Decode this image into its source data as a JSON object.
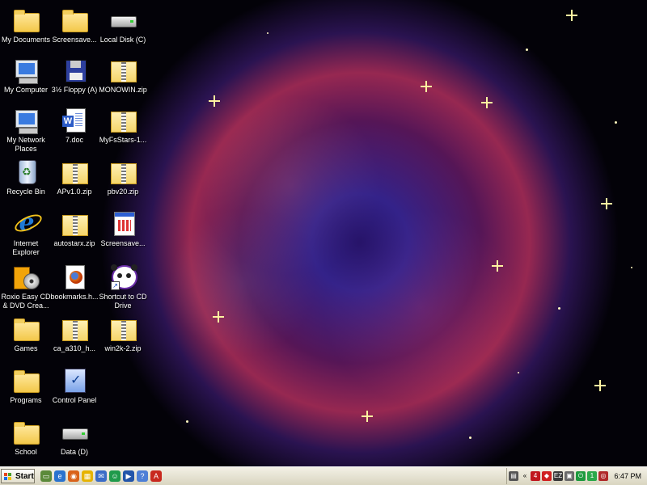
{
  "desktop": {
    "wallpaper": "supernova remnant star field",
    "icons": [
      {
        "label": "My Documents",
        "icon": "folder-icon"
      },
      {
        "label": "Screensave...",
        "icon": "folder-icon"
      },
      {
        "label": "Local Disk (C)",
        "icon": "hard-drive-icon"
      },
      {
        "label": "My Computer",
        "icon": "computer-icon"
      },
      {
        "label": "3½ Floppy (A)",
        "icon": "floppy-drive-icon"
      },
      {
        "label": "MONOWIN.zip",
        "icon": "zip-folder-icon"
      },
      {
        "label": "My Network Places",
        "icon": "network-places-icon"
      },
      {
        "label": "7.doc",
        "icon": "word-document-icon"
      },
      {
        "label": "MyFsStars-1...",
        "icon": "zip-folder-icon"
      },
      {
        "label": "Recycle Bin",
        "icon": "recycle-bin-icon"
      },
      {
        "label": "APv1.0.zip",
        "icon": "zip-folder-icon"
      },
      {
        "label": "pbv20.zip",
        "icon": "zip-folder-icon"
      },
      {
        "label": "Internet Explorer",
        "icon": "internet-explorer-icon"
      },
      {
        "label": "autostarx.zip",
        "icon": "zip-folder-icon"
      },
      {
        "label": "Screensave...",
        "icon": "screensaver-file-icon"
      },
      {
        "label": "Roxio Easy CD & DVD Crea...",
        "icon": "roxio-cd-icon"
      },
      {
        "label": "bookmarks.h...",
        "icon": "firefox-html-icon"
      },
      {
        "label": "Shortcut to CD Drive",
        "icon": "panda-cd-shortcut-icon"
      },
      {
        "label": "Games",
        "icon": "folder-icon"
      },
      {
        "label": "ca_a310_h...",
        "icon": "zip-folder-icon"
      },
      {
        "label": "win2k-2.zip",
        "icon": "zip-folder-icon"
      },
      {
        "label": "Programs",
        "icon": "folder-icon"
      },
      {
        "label": "Control Panel",
        "icon": "control-panel-icon"
      },
      {
        "label": "School",
        "icon": "folder-icon"
      },
      {
        "label": "Data (D)",
        "icon": "drive-icon"
      }
    ]
  },
  "taskbar": {
    "start_label": "Start",
    "quick_launch": [
      "show-desktop-icon",
      "internet-explorer-icon",
      "firefox-icon",
      "media-icon",
      "outlook-icon",
      "messenger-icon",
      "windows-media-player-icon",
      "help-icon",
      "adobe-icon"
    ],
    "tray_icons": [
      "clipboard-icon",
      "chevron-left-icon",
      "logmein-icon",
      "antivirus-icon",
      "ez-icon",
      "network-icon",
      "power-icon",
      "green-app-icon",
      "monitor-app-icon"
    ],
    "clock": "6:47 PM"
  },
  "colors": {
    "taskbar_bg": "#ece9d8",
    "label_text": "#ffffff"
  }
}
